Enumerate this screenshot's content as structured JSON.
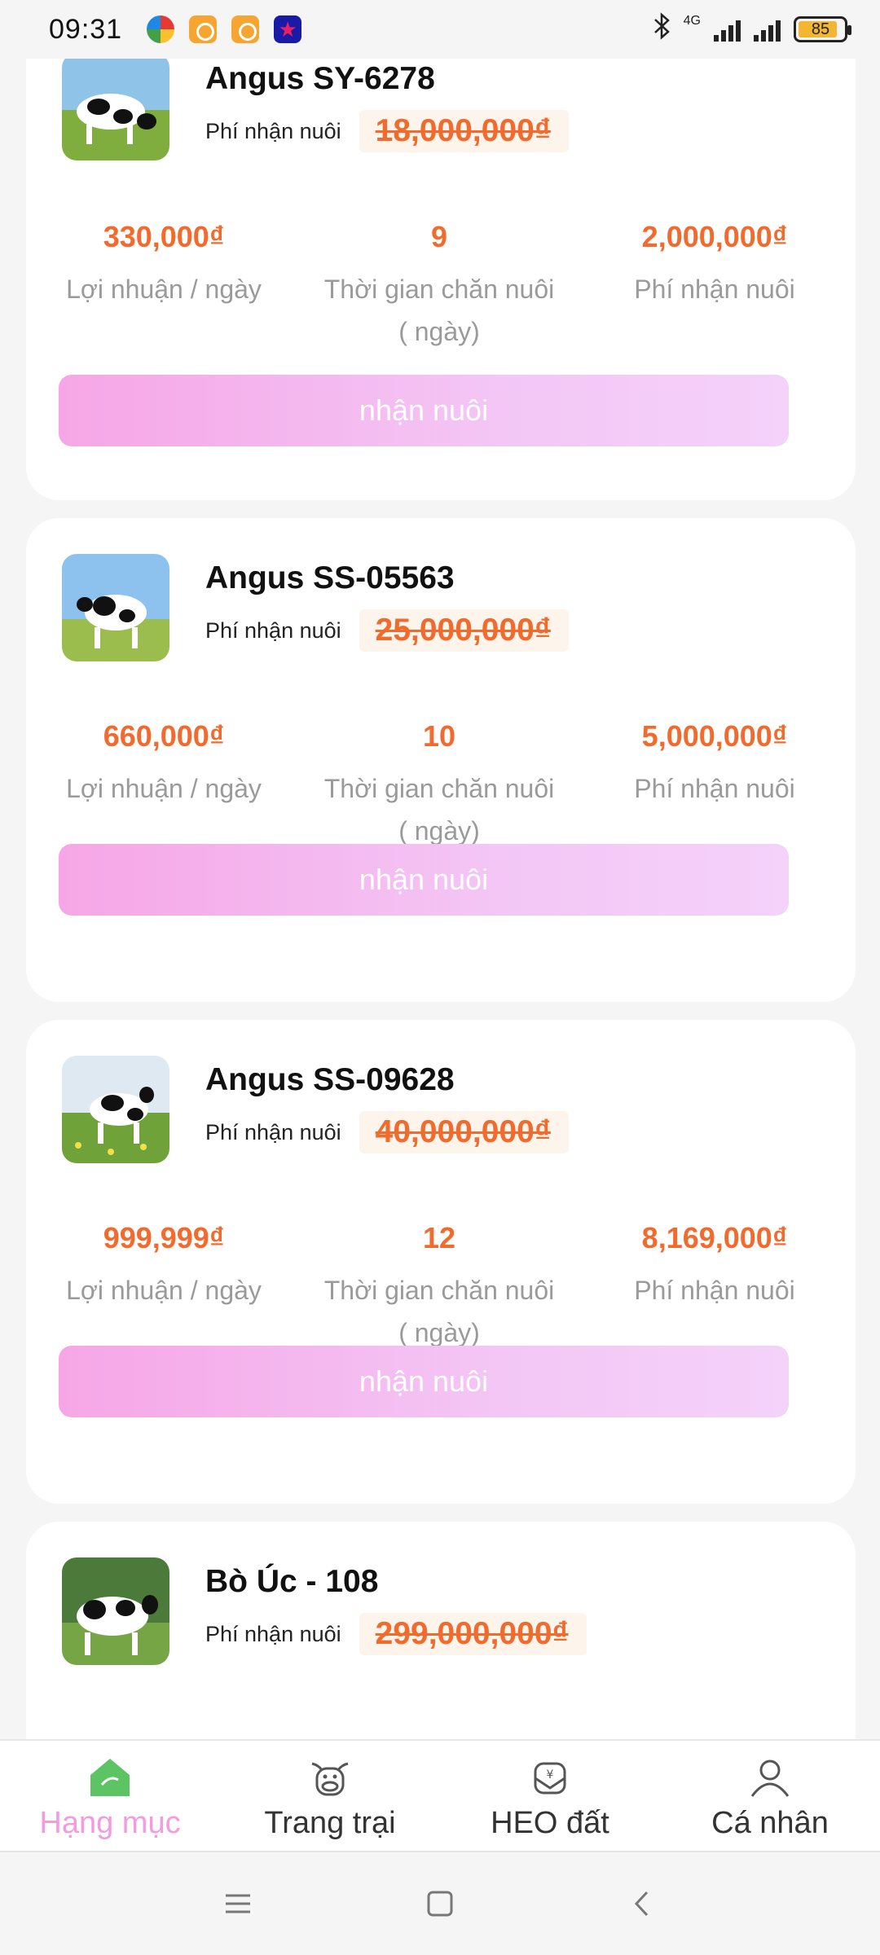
{
  "status_bar": {
    "time": "09:31",
    "network": "4G",
    "battery": "85"
  },
  "items": [
    {
      "name": "Angus SY-6278",
      "fee_label": "Phí nhận nuôi",
      "original_fee": "18,000,000₫",
      "profit_per_day": "330,000₫",
      "profit_label": "Lợi nhuận / ngày",
      "duration": "9",
      "duration_label": "Thời gian chăn nuôi ( ngày)",
      "fee": "2,000,000₫",
      "fee_stat_label": "Phí nhận nuôi",
      "button": "nhận nuôi"
    },
    {
      "name": "Angus SS-05563",
      "fee_label": "Phí nhận nuôi",
      "original_fee": "25,000,000₫",
      "profit_per_day": "660,000₫",
      "profit_label": "Lợi nhuận / ngày",
      "duration": "10",
      "duration_label": "Thời gian chăn nuôi ( ngày)",
      "fee": "5,000,000₫",
      "fee_stat_label": "Phí nhận nuôi",
      "button": "nhận nuôi"
    },
    {
      "name": "Angus SS-09628",
      "fee_label": "Phí nhận nuôi",
      "original_fee": "40,000,000₫",
      "profit_per_day": "999,999₫",
      "profit_label": "Lợi nhuận / ngày",
      "duration": "12",
      "duration_label": "Thời gian chăn nuôi ( ngày)",
      "fee": "8,169,000₫",
      "fee_stat_label": "Phí nhận nuôi",
      "button": "nhận nuôi"
    },
    {
      "name": "Bò Úc - 108",
      "fee_label": "Phí nhận nuôi",
      "original_fee": "299,000,000₫"
    }
  ],
  "bottom_nav": [
    {
      "label": "Hạng mục",
      "icon": "home-icon",
      "active": true
    },
    {
      "label": "Trang trại",
      "icon": "cow-icon",
      "active": false
    },
    {
      "label": "HEO đất",
      "icon": "piggy-bank-icon",
      "active": false
    },
    {
      "label": "Cá nhân",
      "icon": "user-icon",
      "active": false
    }
  ],
  "colors": {
    "accent_orange": "#f26b2e",
    "button_gradient_start": "#f6a6e6",
    "button_gradient_end": "#f4d2fa",
    "active_nav": "#f39be0",
    "home_icon_green": "#5cc463"
  }
}
